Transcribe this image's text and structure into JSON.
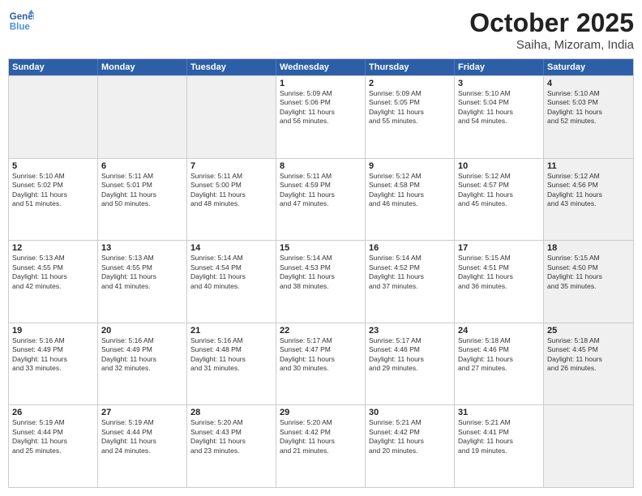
{
  "header": {
    "logo_line1": "General",
    "logo_line2": "Blue",
    "month": "October 2025",
    "location": "Saiha, Mizoram, India"
  },
  "weekdays": [
    "Sunday",
    "Monday",
    "Tuesday",
    "Wednesday",
    "Thursday",
    "Friday",
    "Saturday"
  ],
  "rows": [
    [
      {
        "day": "",
        "text": "",
        "shaded": true
      },
      {
        "day": "",
        "text": "",
        "shaded": true
      },
      {
        "day": "",
        "text": "",
        "shaded": true
      },
      {
        "day": "1",
        "text": "Sunrise: 5:09 AM\nSunset: 5:06 PM\nDaylight: 11 hours\nand 56 minutes."
      },
      {
        "day": "2",
        "text": "Sunrise: 5:09 AM\nSunset: 5:05 PM\nDaylight: 11 hours\nand 55 minutes."
      },
      {
        "day": "3",
        "text": "Sunrise: 5:10 AM\nSunset: 5:04 PM\nDaylight: 11 hours\nand 54 minutes."
      },
      {
        "day": "4",
        "text": "Sunrise: 5:10 AM\nSunset: 5:03 PM\nDaylight: 11 hours\nand 52 minutes.",
        "shaded": true
      }
    ],
    [
      {
        "day": "5",
        "text": "Sunrise: 5:10 AM\nSunset: 5:02 PM\nDaylight: 11 hours\nand 51 minutes."
      },
      {
        "day": "6",
        "text": "Sunrise: 5:11 AM\nSunset: 5:01 PM\nDaylight: 11 hours\nand 50 minutes."
      },
      {
        "day": "7",
        "text": "Sunrise: 5:11 AM\nSunset: 5:00 PM\nDaylight: 11 hours\nand 48 minutes."
      },
      {
        "day": "8",
        "text": "Sunrise: 5:11 AM\nSunset: 4:59 PM\nDaylight: 11 hours\nand 47 minutes."
      },
      {
        "day": "9",
        "text": "Sunrise: 5:12 AM\nSunset: 4:58 PM\nDaylight: 11 hours\nand 46 minutes."
      },
      {
        "day": "10",
        "text": "Sunrise: 5:12 AM\nSunset: 4:57 PM\nDaylight: 11 hours\nand 45 minutes."
      },
      {
        "day": "11",
        "text": "Sunrise: 5:12 AM\nSunset: 4:56 PM\nDaylight: 11 hours\nand 43 minutes.",
        "shaded": true
      }
    ],
    [
      {
        "day": "12",
        "text": "Sunrise: 5:13 AM\nSunset: 4:55 PM\nDaylight: 11 hours\nand 42 minutes."
      },
      {
        "day": "13",
        "text": "Sunrise: 5:13 AM\nSunset: 4:55 PM\nDaylight: 11 hours\nand 41 minutes."
      },
      {
        "day": "14",
        "text": "Sunrise: 5:14 AM\nSunset: 4:54 PM\nDaylight: 11 hours\nand 40 minutes."
      },
      {
        "day": "15",
        "text": "Sunrise: 5:14 AM\nSunset: 4:53 PM\nDaylight: 11 hours\nand 38 minutes."
      },
      {
        "day": "16",
        "text": "Sunrise: 5:14 AM\nSunset: 4:52 PM\nDaylight: 11 hours\nand 37 minutes."
      },
      {
        "day": "17",
        "text": "Sunrise: 5:15 AM\nSunset: 4:51 PM\nDaylight: 11 hours\nand 36 minutes."
      },
      {
        "day": "18",
        "text": "Sunrise: 5:15 AM\nSunset: 4:50 PM\nDaylight: 11 hours\nand 35 minutes.",
        "shaded": true
      }
    ],
    [
      {
        "day": "19",
        "text": "Sunrise: 5:16 AM\nSunset: 4:49 PM\nDaylight: 11 hours\nand 33 minutes."
      },
      {
        "day": "20",
        "text": "Sunrise: 5:16 AM\nSunset: 4:49 PM\nDaylight: 11 hours\nand 32 minutes."
      },
      {
        "day": "21",
        "text": "Sunrise: 5:16 AM\nSunset: 4:48 PM\nDaylight: 11 hours\nand 31 minutes."
      },
      {
        "day": "22",
        "text": "Sunrise: 5:17 AM\nSunset: 4:47 PM\nDaylight: 11 hours\nand 30 minutes."
      },
      {
        "day": "23",
        "text": "Sunrise: 5:17 AM\nSunset: 4:46 PM\nDaylight: 11 hours\nand 29 minutes."
      },
      {
        "day": "24",
        "text": "Sunrise: 5:18 AM\nSunset: 4:46 PM\nDaylight: 11 hours\nand 27 minutes."
      },
      {
        "day": "25",
        "text": "Sunrise: 5:18 AM\nSunset: 4:45 PM\nDaylight: 11 hours\nand 26 minutes.",
        "shaded": true
      }
    ],
    [
      {
        "day": "26",
        "text": "Sunrise: 5:19 AM\nSunset: 4:44 PM\nDaylight: 11 hours\nand 25 minutes."
      },
      {
        "day": "27",
        "text": "Sunrise: 5:19 AM\nSunset: 4:44 PM\nDaylight: 11 hours\nand 24 minutes."
      },
      {
        "day": "28",
        "text": "Sunrise: 5:20 AM\nSunset: 4:43 PM\nDaylight: 11 hours\nand 23 minutes."
      },
      {
        "day": "29",
        "text": "Sunrise: 5:20 AM\nSunset: 4:42 PM\nDaylight: 11 hours\nand 21 minutes."
      },
      {
        "day": "30",
        "text": "Sunrise: 5:21 AM\nSunset: 4:42 PM\nDaylight: 11 hours\nand 20 minutes."
      },
      {
        "day": "31",
        "text": "Sunrise: 5:21 AM\nSunset: 4:41 PM\nDaylight: 11 hours\nand 19 minutes."
      },
      {
        "day": "",
        "text": "",
        "shaded": true
      }
    ]
  ]
}
